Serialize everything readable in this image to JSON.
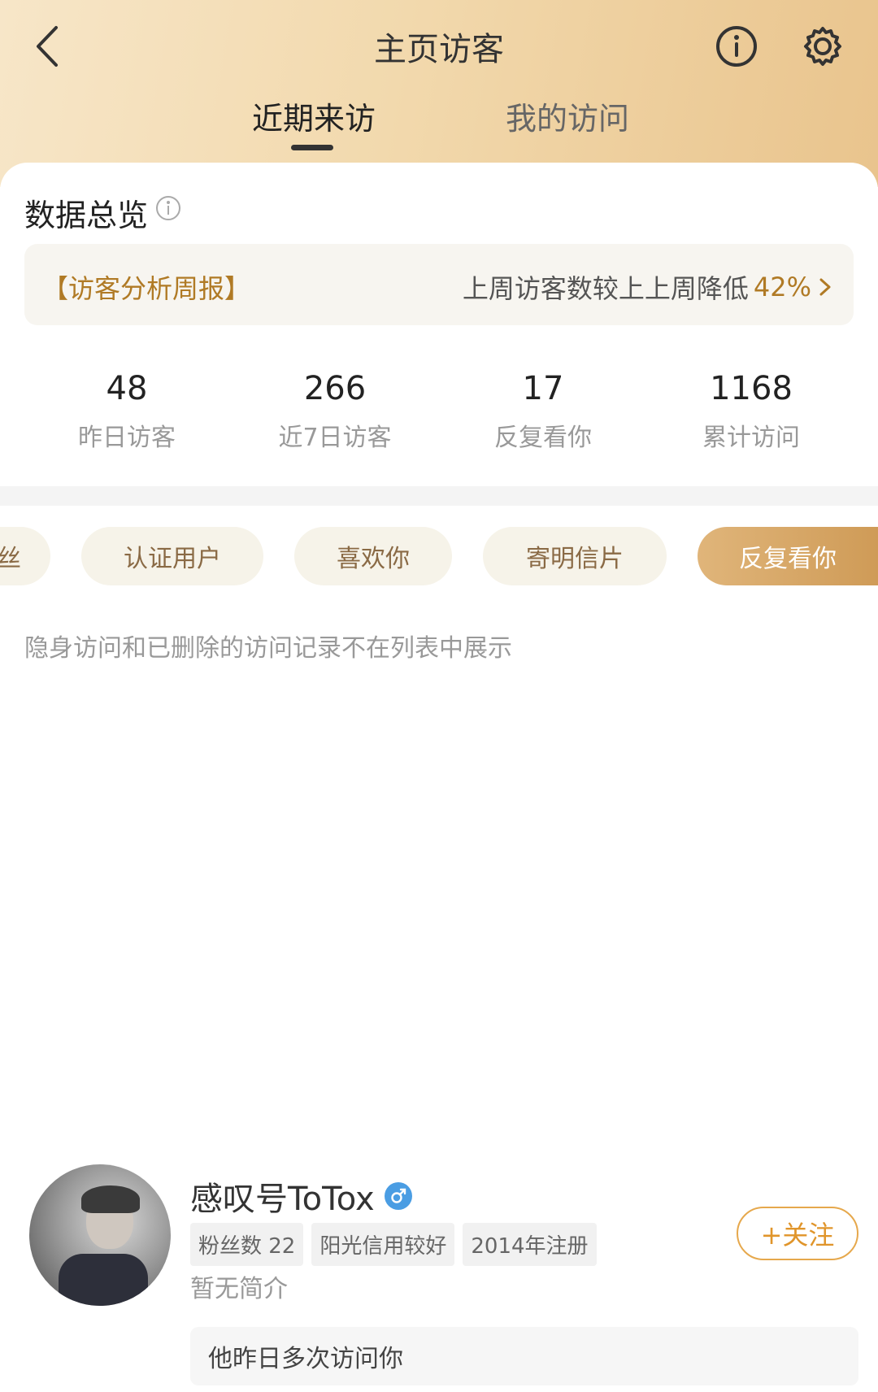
{
  "header": {
    "title": "主页访客",
    "tabs": [
      {
        "label": "近期来访",
        "active": true
      },
      {
        "label": "我的访问",
        "active": false
      }
    ]
  },
  "icons": {
    "back": "chevron-left-icon",
    "info": "info-icon",
    "settings": "gear-icon"
  },
  "overview": {
    "title": "数据总览",
    "weekly_report": {
      "label": "【访客分析周报】",
      "text": "上周访客数较上上周降低",
      "percent": "42%"
    },
    "stats": [
      {
        "value": "48",
        "label": "昨日访客"
      },
      {
        "value": "266",
        "label": "近7日访客"
      },
      {
        "value": "17",
        "label": "反复看你"
      },
      {
        "value": "1168",
        "label": "累计访问"
      }
    ]
  },
  "filters": [
    {
      "label": "丝",
      "active": false
    },
    {
      "label": "认证用户",
      "active": false
    },
    {
      "label": "喜欢你",
      "active": false
    },
    {
      "label": "寄明信片",
      "active": false
    },
    {
      "label": "反复看你",
      "active": true
    }
  ],
  "notice": "隐身访问和已删除的访问记录不在列表中展示",
  "visitor": {
    "name": "感叹号ToTox",
    "gender": "♂",
    "tags": [
      "粉丝数 22",
      "阳光信用较好",
      "2014年注册"
    ],
    "bio": "暂无简介",
    "follow_label": "+关注",
    "visit_note": "他昨日多次访问你"
  },
  "colors": {
    "accent": "#b07a25",
    "active_chip": "#d9a96a",
    "follow": "#e0952b"
  }
}
